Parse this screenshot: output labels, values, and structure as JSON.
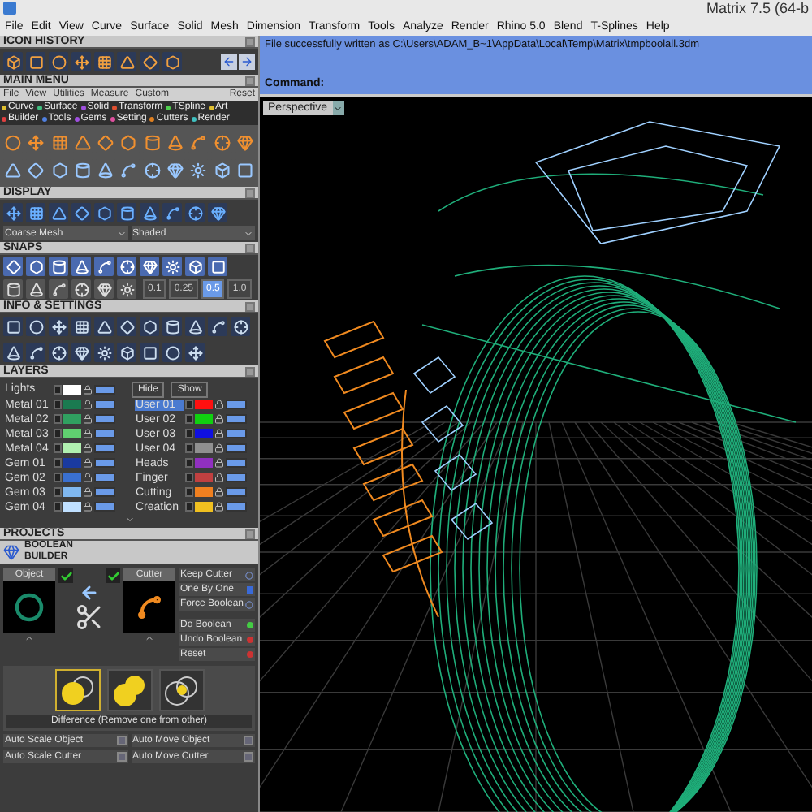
{
  "window": {
    "title": "Matrix 7.5 (64-b"
  },
  "menu_bar": [
    "File",
    "Edit",
    "View",
    "Curve",
    "Surface",
    "Solid",
    "Mesh",
    "Dimension",
    "Transform",
    "Tools",
    "Analyze",
    "Render",
    "Rhino 5.0",
    "Blend",
    "T-Splines",
    "Help"
  ],
  "icon_history": {
    "title": "ICON HISTORY"
  },
  "main_menu": {
    "title": "MAIN MENU",
    "menu": [
      "File",
      "View",
      "Utilities",
      "Measure",
      "Custom"
    ],
    "reset": "Reset",
    "tabs": [
      {
        "label": "Curve",
        "color": "#e0c030"
      },
      {
        "label": "Surface",
        "color": "#40c080"
      },
      {
        "label": "Solid",
        "color": "#a050e0"
      },
      {
        "label": "Transform",
        "color": "#e05030"
      },
      {
        "label": "TSpline",
        "color": "#50d050"
      },
      {
        "label": "Art",
        "color": "#e0c030"
      },
      {
        "label": "Builder",
        "color": "#e04040"
      },
      {
        "label": "Tools",
        "color": "#5080e0"
      },
      {
        "label": "Gems",
        "color": "#a050e0"
      },
      {
        "label": "Setting",
        "color": "#e050a0"
      },
      {
        "label": "Cutters",
        "color": "#e08020"
      },
      {
        "label": "Render",
        "color": "#40c0c0"
      }
    ]
  },
  "display": {
    "title": "DISPLAY",
    "mesh": "Coarse Mesh",
    "shading": "Shaded"
  },
  "snaps": {
    "title": "SNAPS",
    "steps": [
      {
        "label": "0.1",
        "selected": false
      },
      {
        "label": "0.25",
        "selected": false
      },
      {
        "label": "0.5",
        "selected": true
      },
      {
        "label": "1.0",
        "selected": false
      }
    ]
  },
  "info_settings": {
    "title": "INFO & SETTINGS"
  },
  "layers": {
    "title": "LAYERS",
    "lights": {
      "name": "Lights",
      "color": "#ffffff",
      "visible": true
    },
    "hide": "Hide",
    "show": "Show",
    "left": [
      {
        "name": "Metal 01",
        "color": "#1a7a50",
        "selected": false,
        "visible": true
      },
      {
        "name": "Metal 02",
        "color": "#30a060",
        "selected": false,
        "visible": true
      },
      {
        "name": "Metal 03",
        "color": "#60d070",
        "selected": false,
        "visible": true
      },
      {
        "name": "Metal 04",
        "color": "#b0f0b0",
        "selected": false,
        "visible": true
      },
      {
        "name": "Gem 01",
        "color": "#1a3aa0",
        "selected": false,
        "visible": true
      },
      {
        "name": "Gem 02",
        "color": "#3a70d0",
        "selected": false,
        "visible": true
      },
      {
        "name": "Gem 03",
        "color": "#80b8f0",
        "selected": false,
        "visible": true
      },
      {
        "name": "Gem 04",
        "color": "#c0e0ff",
        "selected": false,
        "visible": true
      }
    ],
    "right": [
      {
        "name": "User 01",
        "color": "#ff1010",
        "selected": true,
        "visible": true
      },
      {
        "name": "User 02",
        "color": "#10d010",
        "selected": false,
        "visible": true
      },
      {
        "name": "User 03",
        "color": "#1010e0",
        "selected": false,
        "visible": true
      },
      {
        "name": "User 04",
        "color": "#909090",
        "selected": false,
        "visible": true
      },
      {
        "name": "Heads",
        "color": "#9030c0",
        "selected": false,
        "visible": true
      },
      {
        "name": "Finger",
        "color": "#c04040",
        "selected": false,
        "visible": true
      },
      {
        "name": "Cutting",
        "color": "#f08020",
        "selected": false,
        "visible": true
      },
      {
        "name": "Creation",
        "color": "#f0c020",
        "selected": false,
        "visible": true
      }
    ]
  },
  "projects": {
    "title": "PROJECTS"
  },
  "boolean_builder": {
    "title": "BOOLEAN BUILDER",
    "object_label": "Object",
    "cutter_label": "Cutter",
    "object_checked": true,
    "cutter_checked": true,
    "options": [
      {
        "label": "Keep Cutter",
        "kind": "radio"
      },
      {
        "label": "One By One",
        "kind": "toggle"
      },
      {
        "label": "Force Boolean",
        "kind": "radio"
      },
      {
        "label": "Do Boolean",
        "kind": "go"
      },
      {
        "label": "Undo Boolean",
        "kind": "stop"
      },
      {
        "label": "Reset",
        "kind": "stop"
      }
    ],
    "operations": [
      {
        "kind": "difference",
        "selected": true
      },
      {
        "kind": "union",
        "selected": false
      },
      {
        "kind": "intersection",
        "selected": false
      }
    ],
    "operation_caption": "Difference (Remove one from other)",
    "auto": [
      "Auto Scale Object",
      "Auto Move Object",
      "Auto Scale Cutter",
      "Auto Move Cutter"
    ]
  },
  "command": {
    "history": "File successfully written as C:\\Users\\ADAM_B~1\\AppData\\Local\\Temp\\Matrix\\tmpboolall.3dm",
    "prompt": "Command:"
  },
  "viewport": {
    "label": "Perspective"
  }
}
